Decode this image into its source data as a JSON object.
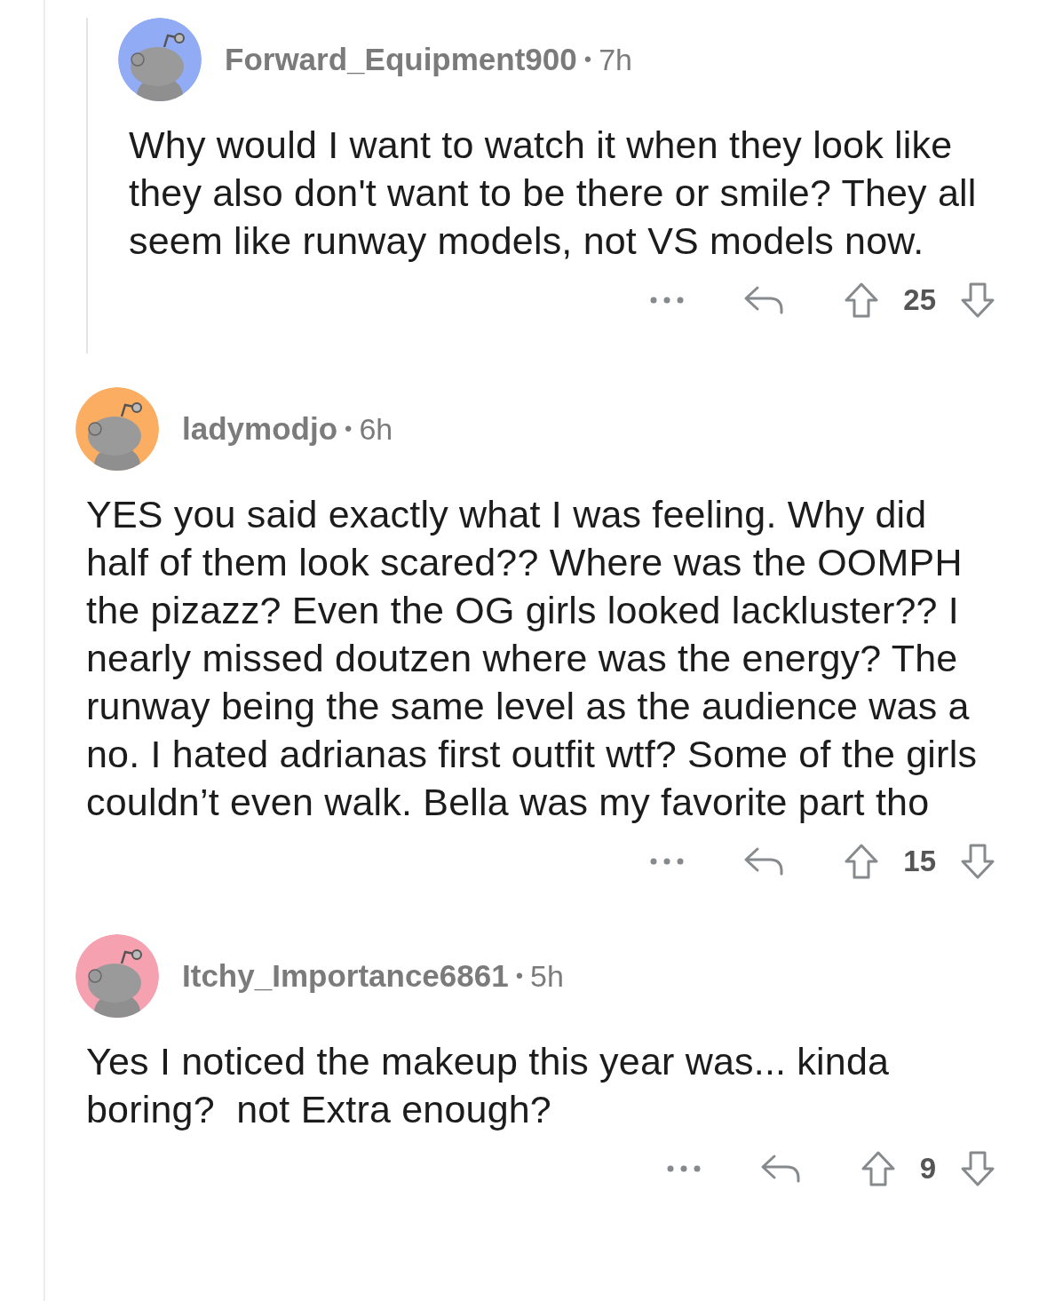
{
  "comments": [
    {
      "username": "Forward_Equipment900",
      "separator": "•",
      "time": "7h",
      "color": "#91abf5",
      "indented": true,
      "body": "Why would I want to watch it when they look like they also don't want to be there or smile? They all seem like runway models, not VS models now.",
      "votes": "25"
    },
    {
      "username": "ladymodjo",
      "separator": "•",
      "time": "6h",
      "color": "#fbae62",
      "indented": false,
      "body": "YES you said exactly what I was feeling. Why did half of them look scared?? Where was the OOMPH the pizazz? Even the OG girls looked lackluster?? I nearly missed doutzen where was the energy? The runway being the same level as the audience was a no. I hated adrianas first outfit wtf? Some of the girls couldn’t even walk. Bella was my favorite part tho",
      "votes": "15"
    },
    {
      "username": "Itchy_Importance6861",
      "separator": "•",
      "time": "5h",
      "color": "#f5a1b0",
      "indented": false,
      "body": "Yes I noticed the makeup this year was... kinda boring?  not Extra enough?",
      "votes": "9"
    }
  ]
}
